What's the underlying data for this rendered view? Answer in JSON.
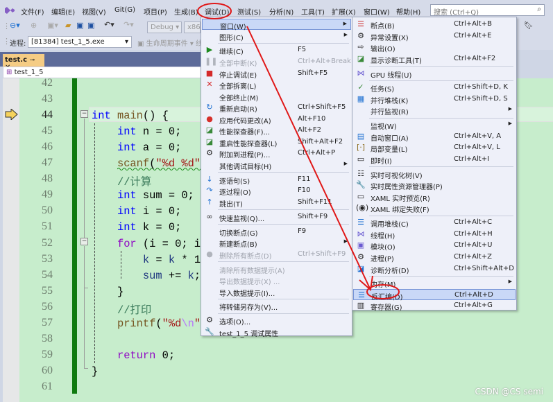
{
  "menubar": {
    "items": [
      "文件(F)",
      "编辑(E)",
      "视图(V)",
      "Git(G)",
      "项目(P)",
      "生成(B)",
      "调试(D)",
      "测试(S)",
      "分析(N)",
      "工具(T)",
      "扩展(X)",
      "窗口(W)",
      "帮助(H)"
    ],
    "search_placeholder": "搜索 (Ctrl+Q)"
  },
  "toolbar": {
    "config": "Debug",
    "platform": "x86",
    "process_label": "进程:",
    "process": "[81384] test_1_5.exe",
    "lifecycle": "生命周期事件",
    "thread": "线"
  },
  "tab": {
    "name": "test.c"
  },
  "nav": {
    "scope": "test_1_5"
  },
  "editor": {
    "line_numbers": [
      "42",
      "43",
      "44",
      "45",
      "46",
      "47",
      "48",
      "49",
      "50",
      "51",
      "52",
      "53",
      "54",
      "55",
      "56",
      "57",
      "58",
      "59",
      "60",
      "61"
    ],
    "lines": [
      [],
      [],
      [
        [
          "int",
          "kw"
        ],
        [
          " ",
          ""
        ],
        [
          "main",
          "fn"
        ],
        [
          "() {",
          ""
        ]
      ],
      [
        [
          "    ",
          ""
        ],
        [
          "int",
          "kw"
        ],
        [
          " n = 0;",
          ""
        ]
      ],
      [
        [
          "    ",
          ""
        ],
        [
          "int",
          "kw"
        ],
        [
          " a = 0;",
          ""
        ]
      ],
      [
        [
          "    ",
          ""
        ],
        [
          "scanf",
          "fn"
        ],
        [
          "(",
          ""
        ],
        [
          "\"%d %d\"",
          "str"
        ]
      ],
      [
        [
          "    ",
          ""
        ],
        [
          "//计算",
          "cm"
        ]
      ],
      [
        [
          "    ",
          ""
        ],
        [
          "int",
          "kw"
        ],
        [
          " sum = 0;",
          ""
        ]
      ],
      [
        [
          "    ",
          ""
        ],
        [
          "int",
          "kw"
        ],
        [
          " i = 0;",
          ""
        ]
      ],
      [
        [
          "    ",
          ""
        ],
        [
          "int",
          "kw"
        ],
        [
          " k = 0;",
          ""
        ]
      ],
      [
        [
          "    ",
          ""
        ],
        [
          "for",
          "ctl"
        ],
        [
          " (i = 0; i",
          ""
        ]
      ],
      [
        [
          "        ",
          ""
        ],
        [
          "k",
          "var"
        ],
        [
          " = ",
          ""
        ],
        [
          "k",
          "var"
        ],
        [
          " * 1",
          ""
        ]
      ],
      [
        [
          "        ",
          ""
        ],
        [
          "sum",
          "var"
        ],
        [
          " += ",
          ""
        ],
        [
          "k",
          "var"
        ],
        [
          ";",
          ""
        ]
      ],
      [
        [
          "    }",
          ""
        ]
      ],
      [
        [
          "    ",
          ""
        ],
        [
          "//打印",
          "cm"
        ]
      ],
      [
        [
          "    ",
          ""
        ],
        [
          "printf",
          "fn"
        ],
        [
          "(",
          ""
        ],
        [
          "\"%d",
          "str"
        ],
        [
          "\\n",
          "esc"
        ],
        [
          "\"",
          "str"
        ]
      ],
      [],
      [
        [
          "    ",
          ""
        ],
        [
          "return",
          "ctl"
        ],
        [
          " 0;",
          ""
        ]
      ],
      [
        [
          "}",
          ""
        ]
      ],
      []
    ]
  },
  "debug_menu": {
    "items": [
      {
        "label": "窗口(W)",
        "sub": true,
        "hl": true
      },
      {
        "label": "图形(C)",
        "sub": true
      },
      {
        "sep": true
      },
      {
        "label": "继续(C)",
        "shortcut": "F5",
        "icon": "▶",
        "icon_name": "continue-icon",
        "icolor": "#1e8a1e"
      },
      {
        "label": "全部中断(K)",
        "shortcut": "Ctrl+Alt+Break",
        "icon": "❚❚",
        "icon_name": "pause-icon",
        "dis": true
      },
      {
        "label": "停止调试(E)",
        "shortcut": "Shift+F5",
        "icon": "■",
        "icon_name": "stop-icon",
        "icolor": "#d42a2a"
      },
      {
        "label": "全部拆离(L)",
        "icon": "✕",
        "icon_name": "detach-icon",
        "icolor": "#d42a2a"
      },
      {
        "label": "全部终止(M)"
      },
      {
        "label": "重新启动(R)",
        "shortcut": "Ctrl+Shift+F5",
        "icon": "↻",
        "icon_name": "restart-icon",
        "icolor": "#1c6fd1"
      },
      {
        "label": "应用代码更改(A)",
        "shortcut": "Alt+F10",
        "icon": "●",
        "icon_name": "hot-reload-icon",
        "icolor": "#d6302a"
      },
      {
        "label": "性能探查器(F)...",
        "shortcut": "Alt+F2",
        "icon": "◪",
        "icon_name": "profiler-icon",
        "icolor": "#3a8a3a"
      },
      {
        "label": "重启性能探查器(L)",
        "shortcut": "Shift+Alt+F2",
        "icon": "◪",
        "icon_name": "restart-profiler-icon",
        "icolor": "#3a8a3a"
      },
      {
        "label": "附加到进程(P)...",
        "shortcut": "Ctrl+Alt+P",
        "icon": "⚙",
        "icon_name": "attach-icon"
      },
      {
        "label": "其他调试目标(H)",
        "sub": true
      },
      {
        "sep": true
      },
      {
        "label": "逐语句(S)",
        "shortcut": "F11",
        "icon": "↓",
        "icon_name": "step-into-icon",
        "icolor": "#1c6fd1"
      },
      {
        "label": "逐过程(O)",
        "shortcut": "F10",
        "icon": "↷",
        "icon_name": "step-over-icon",
        "icolor": "#1c6fd1"
      },
      {
        "label": "跳出(T)",
        "shortcut": "Shift+F11",
        "icon": "↑",
        "icon_name": "step-out-icon",
        "icolor": "#1c6fd1"
      },
      {
        "sep": true
      },
      {
        "label": "快速监视(Q)...",
        "shortcut": "Shift+F9",
        "icon": "∞",
        "icon_name": "quickwatch-icon"
      },
      {
        "sep": true
      },
      {
        "label": "切换断点(G)",
        "shortcut": "F9"
      },
      {
        "label": "新建断点(B)",
        "sub": true
      },
      {
        "label": "删除所有断点(D)",
        "shortcut": "Ctrl+Shift+F9",
        "icon": "●",
        "icon_name": "delete-breakpoints-icon",
        "dis": true
      },
      {
        "sep": true
      },
      {
        "label": "清除所有数据提示(A)",
        "dis": true
      },
      {
        "label": "导出数据提示(X) ...",
        "dis": true
      },
      {
        "label": "导入数据提示(I)..."
      },
      {
        "sep": true
      },
      {
        "label": "将转储另存为(V)..."
      },
      {
        "sep": true
      },
      {
        "label": "选项(O)...",
        "icon": "⚙",
        "icon_name": "options-gear-icon"
      },
      {
        "label": "test_1_5 调试属性",
        "icon": "🔧",
        "icon_name": "wrench-icon"
      }
    ]
  },
  "window_submenu": {
    "items": [
      {
        "label": "断点(B)",
        "shortcut": "Ctrl+Alt+B",
        "icon": "☰",
        "icon_name": "breakpoints-icon",
        "icolor": "#c33"
      },
      {
        "label": "异常设置(X)",
        "shortcut": "Ctrl+Alt+E",
        "icon": "⚙",
        "icon_name": "exception-settings-icon"
      },
      {
        "label": "输出(O)",
        "icon": "⇨",
        "icon_name": "output-icon"
      },
      {
        "label": "显示诊断工具(T)",
        "shortcut": "Ctrl+Alt+F2",
        "icon": "◪",
        "icon_name": "diagnostic-tools-icon",
        "icolor": "#3a8a3a"
      },
      {
        "sep": true
      },
      {
        "label": "GPU 线程(U)",
        "icon": "⋈",
        "icon_name": "gpu-threads-icon",
        "icolor": "#6b5bd1"
      },
      {
        "sep": true
      },
      {
        "label": "任务(S)",
        "shortcut": "Ctrl+Shift+D, K",
        "icon": "✓",
        "icon_name": "tasks-icon",
        "icolor": "#3a8a3a"
      },
      {
        "label": "并行堆栈(K)",
        "shortcut": "Ctrl+Shift+D, S",
        "icon": "▦",
        "icon_name": "parallel-stacks-icon",
        "icolor": "#1c6fd1"
      },
      {
        "label": "并行监视(R)",
        "sub": true
      },
      {
        "sep": true
      },
      {
        "label": "监视(W)",
        "sub": true
      },
      {
        "label": "自动窗口(A)",
        "shortcut": "Ctrl+Alt+V, A",
        "icon": "▤",
        "icon_name": "autos-icon",
        "icolor": "#1c6fd1"
      },
      {
        "label": "局部变量(L)",
        "shortcut": "Ctrl+Alt+V, L",
        "icon": "[·]",
        "icon_name": "locals-icon",
        "icolor": "#8a6a1a"
      },
      {
        "label": "即时(I)",
        "shortcut": "Ctrl+Alt+I",
        "icon": "▭",
        "icon_name": "immediate-icon"
      },
      {
        "sep": true
      },
      {
        "label": "实时可视化树(V)",
        "icon": "☷",
        "icon_name": "visual-tree-icon"
      },
      {
        "label": "实时属性资源管理器(P)",
        "icon": "🔧",
        "icon_name": "property-explorer-icon"
      },
      {
        "label": "XAML 实时预览(R)",
        "icon": "▭",
        "icon_name": "xaml-preview-icon"
      },
      {
        "label": "XAML 绑定失败(F)",
        "icon": "(◉)",
        "icon_name": "xaml-binding-icon"
      },
      {
        "sep": true
      },
      {
        "label": "调用堆栈(C)",
        "shortcut": "Ctrl+Alt+C",
        "icon": "☰",
        "icon_name": "call-stack-icon",
        "icolor": "#1c6fd1"
      },
      {
        "label": "线程(H)",
        "shortcut": "Ctrl+Alt+H",
        "icon": "⋈",
        "icon_name": "threads-icon",
        "icolor": "#6b5bd1"
      },
      {
        "label": "模块(O)",
        "shortcut": "Ctrl+Alt+U",
        "icon": "▣",
        "icon_name": "modules-icon",
        "icolor": "#6b5bd1"
      },
      {
        "label": "进程(P)",
        "shortcut": "Ctrl+Alt+Z",
        "icon": "⚙",
        "icon_name": "processes-icon"
      },
      {
        "label": "诊断分析(D)",
        "shortcut": "Ctrl+Shift+Alt+D",
        "icon": "◪",
        "icon_name": "diagnostic-analysis-icon",
        "icolor": "#1c6fd1"
      },
      {
        "sep": true
      },
      {
        "label": "内存(M)",
        "sub": true
      },
      {
        "label": "反汇编(D)",
        "shortcut": "Ctrl+Alt+D",
        "icon": "☰",
        "icon_name": "disassembly-icon",
        "icolor": "#1c6fd1",
        "hl": true
      },
      {
        "label": "寄存器(G)",
        "shortcut": "Ctrl+Alt+G",
        "icon": "▥",
        "icon_name": "registers-icon"
      }
    ]
  },
  "annotation_color": "#e01818",
  "watermark": "CSDN @CS semi"
}
